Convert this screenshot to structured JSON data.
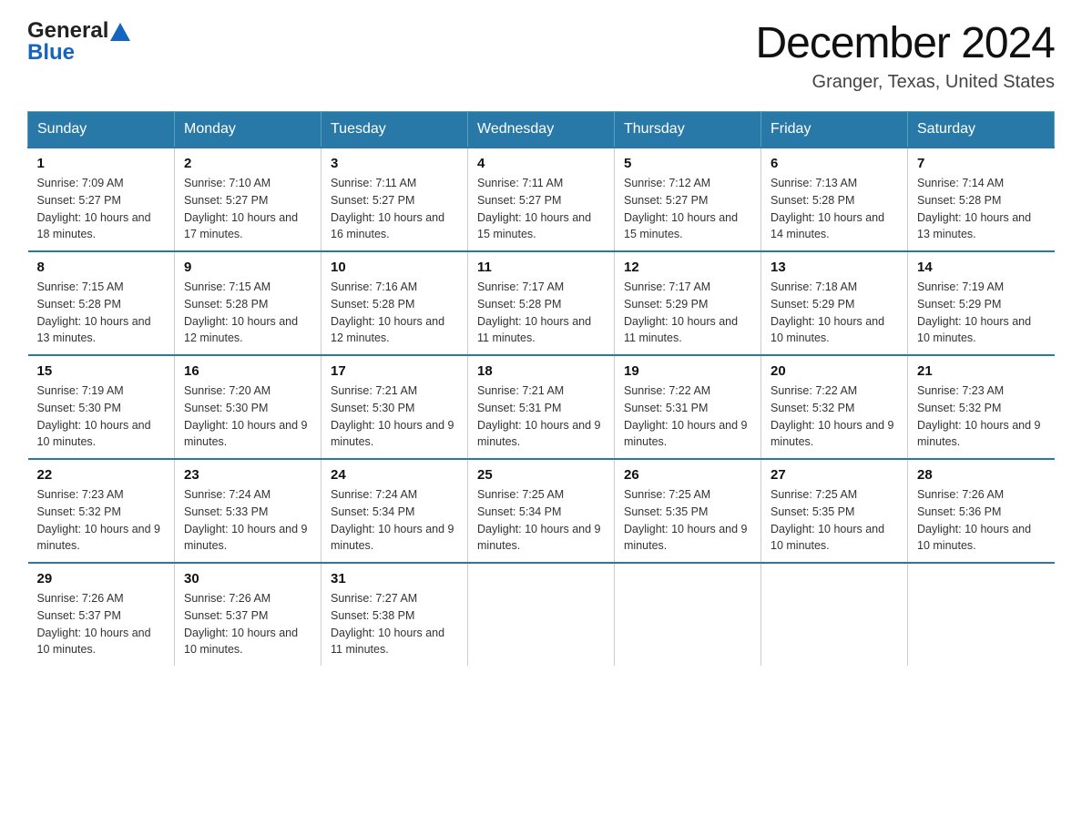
{
  "header": {
    "logo_text_general": "General",
    "logo_text_blue": "Blue",
    "calendar_title": "December 2024",
    "calendar_subtitle": "Granger, Texas, United States"
  },
  "weekdays": [
    "Sunday",
    "Monday",
    "Tuesday",
    "Wednesday",
    "Thursday",
    "Friday",
    "Saturday"
  ],
  "weeks": [
    [
      {
        "day": "1",
        "sunrise": "Sunrise: 7:09 AM",
        "sunset": "Sunset: 5:27 PM",
        "daylight": "Daylight: 10 hours and 18 minutes."
      },
      {
        "day": "2",
        "sunrise": "Sunrise: 7:10 AM",
        "sunset": "Sunset: 5:27 PM",
        "daylight": "Daylight: 10 hours and 17 minutes."
      },
      {
        "day": "3",
        "sunrise": "Sunrise: 7:11 AM",
        "sunset": "Sunset: 5:27 PM",
        "daylight": "Daylight: 10 hours and 16 minutes."
      },
      {
        "day": "4",
        "sunrise": "Sunrise: 7:11 AM",
        "sunset": "Sunset: 5:27 PM",
        "daylight": "Daylight: 10 hours and 15 minutes."
      },
      {
        "day": "5",
        "sunrise": "Sunrise: 7:12 AM",
        "sunset": "Sunset: 5:27 PM",
        "daylight": "Daylight: 10 hours and 15 minutes."
      },
      {
        "day": "6",
        "sunrise": "Sunrise: 7:13 AM",
        "sunset": "Sunset: 5:28 PM",
        "daylight": "Daylight: 10 hours and 14 minutes."
      },
      {
        "day": "7",
        "sunrise": "Sunrise: 7:14 AM",
        "sunset": "Sunset: 5:28 PM",
        "daylight": "Daylight: 10 hours and 13 minutes."
      }
    ],
    [
      {
        "day": "8",
        "sunrise": "Sunrise: 7:15 AM",
        "sunset": "Sunset: 5:28 PM",
        "daylight": "Daylight: 10 hours and 13 minutes."
      },
      {
        "day": "9",
        "sunrise": "Sunrise: 7:15 AM",
        "sunset": "Sunset: 5:28 PM",
        "daylight": "Daylight: 10 hours and 12 minutes."
      },
      {
        "day": "10",
        "sunrise": "Sunrise: 7:16 AM",
        "sunset": "Sunset: 5:28 PM",
        "daylight": "Daylight: 10 hours and 12 minutes."
      },
      {
        "day": "11",
        "sunrise": "Sunrise: 7:17 AM",
        "sunset": "Sunset: 5:28 PM",
        "daylight": "Daylight: 10 hours and 11 minutes."
      },
      {
        "day": "12",
        "sunrise": "Sunrise: 7:17 AM",
        "sunset": "Sunset: 5:29 PM",
        "daylight": "Daylight: 10 hours and 11 minutes."
      },
      {
        "day": "13",
        "sunrise": "Sunrise: 7:18 AM",
        "sunset": "Sunset: 5:29 PM",
        "daylight": "Daylight: 10 hours and 10 minutes."
      },
      {
        "day": "14",
        "sunrise": "Sunrise: 7:19 AM",
        "sunset": "Sunset: 5:29 PM",
        "daylight": "Daylight: 10 hours and 10 minutes."
      }
    ],
    [
      {
        "day": "15",
        "sunrise": "Sunrise: 7:19 AM",
        "sunset": "Sunset: 5:30 PM",
        "daylight": "Daylight: 10 hours and 10 minutes."
      },
      {
        "day": "16",
        "sunrise": "Sunrise: 7:20 AM",
        "sunset": "Sunset: 5:30 PM",
        "daylight": "Daylight: 10 hours and 9 minutes."
      },
      {
        "day": "17",
        "sunrise": "Sunrise: 7:21 AM",
        "sunset": "Sunset: 5:30 PM",
        "daylight": "Daylight: 10 hours and 9 minutes."
      },
      {
        "day": "18",
        "sunrise": "Sunrise: 7:21 AM",
        "sunset": "Sunset: 5:31 PM",
        "daylight": "Daylight: 10 hours and 9 minutes."
      },
      {
        "day": "19",
        "sunrise": "Sunrise: 7:22 AM",
        "sunset": "Sunset: 5:31 PM",
        "daylight": "Daylight: 10 hours and 9 minutes."
      },
      {
        "day": "20",
        "sunrise": "Sunrise: 7:22 AM",
        "sunset": "Sunset: 5:32 PM",
        "daylight": "Daylight: 10 hours and 9 minutes."
      },
      {
        "day": "21",
        "sunrise": "Sunrise: 7:23 AM",
        "sunset": "Sunset: 5:32 PM",
        "daylight": "Daylight: 10 hours and 9 minutes."
      }
    ],
    [
      {
        "day": "22",
        "sunrise": "Sunrise: 7:23 AM",
        "sunset": "Sunset: 5:32 PM",
        "daylight": "Daylight: 10 hours and 9 minutes."
      },
      {
        "day": "23",
        "sunrise": "Sunrise: 7:24 AM",
        "sunset": "Sunset: 5:33 PM",
        "daylight": "Daylight: 10 hours and 9 minutes."
      },
      {
        "day": "24",
        "sunrise": "Sunrise: 7:24 AM",
        "sunset": "Sunset: 5:34 PM",
        "daylight": "Daylight: 10 hours and 9 minutes."
      },
      {
        "day": "25",
        "sunrise": "Sunrise: 7:25 AM",
        "sunset": "Sunset: 5:34 PM",
        "daylight": "Daylight: 10 hours and 9 minutes."
      },
      {
        "day": "26",
        "sunrise": "Sunrise: 7:25 AM",
        "sunset": "Sunset: 5:35 PM",
        "daylight": "Daylight: 10 hours and 9 minutes."
      },
      {
        "day": "27",
        "sunrise": "Sunrise: 7:25 AM",
        "sunset": "Sunset: 5:35 PM",
        "daylight": "Daylight: 10 hours and 10 minutes."
      },
      {
        "day": "28",
        "sunrise": "Sunrise: 7:26 AM",
        "sunset": "Sunset: 5:36 PM",
        "daylight": "Daylight: 10 hours and 10 minutes."
      }
    ],
    [
      {
        "day": "29",
        "sunrise": "Sunrise: 7:26 AM",
        "sunset": "Sunset: 5:37 PM",
        "daylight": "Daylight: 10 hours and 10 minutes."
      },
      {
        "day": "30",
        "sunrise": "Sunrise: 7:26 AM",
        "sunset": "Sunset: 5:37 PM",
        "daylight": "Daylight: 10 hours and 10 minutes."
      },
      {
        "day": "31",
        "sunrise": "Sunrise: 7:27 AM",
        "sunset": "Sunset: 5:38 PM",
        "daylight": "Daylight: 10 hours and 11 minutes."
      },
      null,
      null,
      null,
      null
    ]
  ]
}
